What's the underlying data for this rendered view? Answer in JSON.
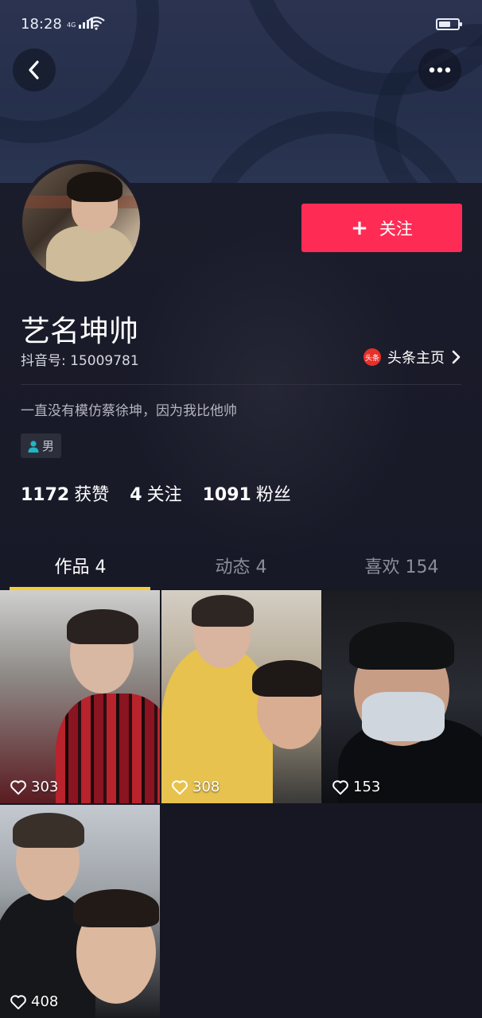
{
  "status_bar": {
    "time": "18:28",
    "network": "4G"
  },
  "profile": {
    "follow_label": "关注",
    "name": "艺名坤帅",
    "douyin_id": "抖音号: 15009781",
    "toutiao_logo_text": "头条",
    "toutiao_label": "头条主页",
    "bio": "一直没有模仿蔡徐坤，因为我比他帅",
    "gender": "男"
  },
  "stats": [
    {
      "value": "1172",
      "label": "获赞"
    },
    {
      "value": "4",
      "label": "关注"
    },
    {
      "value": "1091",
      "label": "粉丝"
    }
  ],
  "tabs": [
    {
      "label": "作品 4",
      "active": true
    },
    {
      "label": "动态 4",
      "active": false
    },
    {
      "label": "喜欢 154",
      "active": false
    }
  ],
  "videos": [
    {
      "likes": "303"
    },
    {
      "likes": "308"
    },
    {
      "likes": "153"
    },
    {
      "likes": "408"
    }
  ],
  "colors": {
    "accent": "#fe2c55",
    "tab_indicator": "#facd2f",
    "background": "#161723"
  },
  "icons": [
    "back-arrow-icon",
    "more-dots-icon",
    "plus-icon",
    "chevron-right-icon",
    "person-icon",
    "heart-outline-icon",
    "wifi-icon",
    "signal-icon",
    "battery-icon"
  ]
}
